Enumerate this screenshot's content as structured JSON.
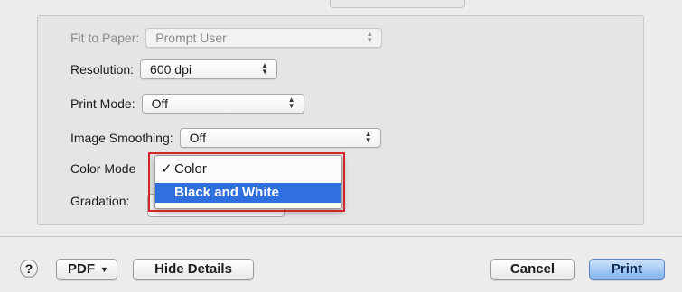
{
  "settings": {
    "fit_to_paper": {
      "label": "Fit to Paper:",
      "value": "Prompt User"
    },
    "resolution": {
      "label": "Resolution:",
      "value": "600 dpi"
    },
    "print_mode": {
      "label": "Print Mode:",
      "value": "Off"
    },
    "image_smoothing": {
      "label": "Image Smoothing:",
      "value": "Off"
    },
    "color_mode": {
      "label": "Color Mode"
    },
    "gradation": {
      "label": "Gradation:"
    }
  },
  "color_mode_menu": {
    "items": [
      {
        "label": "Color",
        "check": "✓"
      },
      {
        "label": "Black and White"
      }
    ]
  },
  "footer": {
    "help": "?",
    "pdf": "PDF",
    "hide_details": "Hide Details",
    "cancel": "Cancel",
    "print": "Print"
  },
  "colors": {
    "highlight_box": "#d2232a",
    "menu_selection": "#2f6fe0",
    "primary_button": "#7fb2ee"
  },
  "icons": {
    "popup_arrows": "up-down-arrows-icon",
    "pdf_caret": "chevron-down-icon",
    "checkmark": "checkmark-icon",
    "help": "question-mark-icon"
  }
}
